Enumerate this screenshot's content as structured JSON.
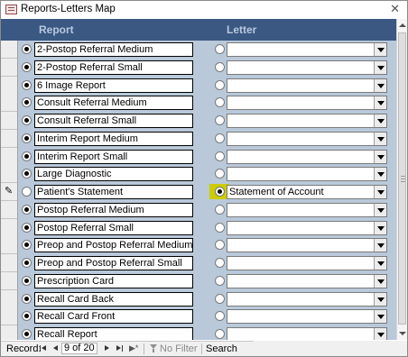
{
  "window": {
    "title": "Reports-Letters Map",
    "close_glyph": "✕"
  },
  "header": {
    "report": "Report",
    "letter": "Letter"
  },
  "rows": [
    {
      "report": "2-Postop Referral Medium",
      "letter": "",
      "report_selected": true,
      "letter_selected": false,
      "current": false
    },
    {
      "report": "2-Postop Referral Small",
      "letter": "",
      "report_selected": true,
      "letter_selected": false,
      "current": false
    },
    {
      "report": "6 Image Report",
      "letter": "",
      "report_selected": true,
      "letter_selected": false,
      "current": false
    },
    {
      "report": "Consult Referral Medium",
      "letter": "",
      "report_selected": true,
      "letter_selected": false,
      "current": false
    },
    {
      "report": "Consult Referral Small",
      "letter": "",
      "report_selected": true,
      "letter_selected": false,
      "current": false
    },
    {
      "report": "Interim Report Medium",
      "letter": "",
      "report_selected": true,
      "letter_selected": false,
      "current": false
    },
    {
      "report": "Interim Report Small",
      "letter": "",
      "report_selected": true,
      "letter_selected": false,
      "current": false
    },
    {
      "report": "Large Diagnostic",
      "letter": "",
      "report_selected": true,
      "letter_selected": false,
      "current": false
    },
    {
      "report": "Patient's Statement",
      "letter": "Statement of Account",
      "report_selected": false,
      "letter_selected": true,
      "current": true
    },
    {
      "report": "Postop Referral Medium",
      "letter": "",
      "report_selected": true,
      "letter_selected": false,
      "current": false
    },
    {
      "report": "Postop Referral Small",
      "letter": "",
      "report_selected": true,
      "letter_selected": false,
      "current": false
    },
    {
      "report": "Preop and Postop Referral Medium",
      "letter": "",
      "report_selected": true,
      "letter_selected": false,
      "current": false
    },
    {
      "report": "Preop and Postop Referral Small",
      "letter": "",
      "report_selected": true,
      "letter_selected": false,
      "current": false
    },
    {
      "report": "Prescription Card",
      "letter": "",
      "report_selected": true,
      "letter_selected": false,
      "current": false
    },
    {
      "report": "Recall Card Back",
      "letter": "",
      "report_selected": true,
      "letter_selected": false,
      "current": false
    },
    {
      "report": "Recall Card Front",
      "letter": "",
      "report_selected": true,
      "letter_selected": false,
      "current": false
    },
    {
      "report": "Recall Report",
      "letter": "",
      "report_selected": true,
      "letter_selected": false,
      "current": false
    }
  ],
  "navigation": {
    "record_label": "Record:",
    "position": "9 of 20",
    "new_glyph": "▶*",
    "no_filter": "No Filter",
    "search": "Search"
  }
}
